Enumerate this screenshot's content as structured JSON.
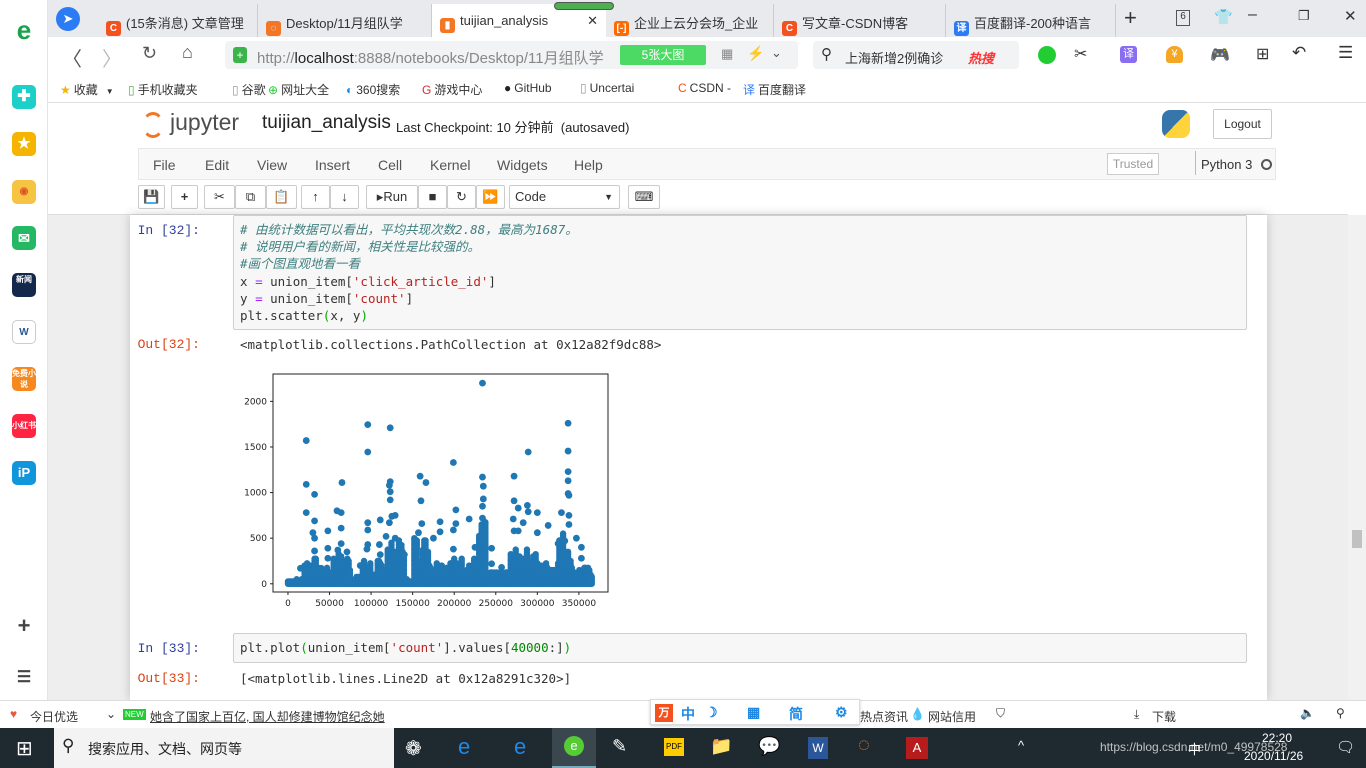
{
  "sidebar": {
    "icons": [
      "ie-logo-icon",
      "plus-app-icon",
      "star-icon",
      "weibo-icon",
      "mail-icon",
      "news-icon",
      "word-icon",
      "novel-icon",
      "xiaohongshu-icon",
      "ip-icon",
      "add-icon",
      "list-icon"
    ],
    "news_label": "新闻",
    "novel_label": "免费小说",
    "xhs_label": "小红书"
  },
  "tabs": [
    {
      "label": "(15条消息) 文章管理",
      "color": "#f4511e",
      "glyph": "C"
    },
    {
      "label": "Desktop/11月组队学",
      "color": "#f37626",
      "glyph": "◌"
    },
    {
      "label": "tuijian_analysis",
      "color": "#f37626",
      "glyph": "▮",
      "active": true
    },
    {
      "label": "企业上云分会场_企业",
      "color": "#ff6a00",
      "glyph": "[-]"
    },
    {
      "label": "写文章-CSDN博客",
      "color": "#f4511e",
      "glyph": "C"
    },
    {
      "label": "百度翻译-200种语言",
      "color": "#2b7bf5",
      "glyph": "译"
    }
  ],
  "tab_count": "6",
  "address": {
    "url_prefix": "http://",
    "url_host": "localhost",
    "url_rest": ":8888/notebooks/Desktop/11月组队学",
    "image_badge": "5张大图",
    "search_text": "上海新增2例确诊",
    "hot_label": "热搜"
  },
  "bookmarks": [
    "收藏",
    "手机收藏夹",
    "谷歌",
    "网址大全",
    "360搜索",
    "游戏中心",
    "GitHub",
    "Uncertai",
    "CSDN -",
    "百度翻译"
  ],
  "jupyter": {
    "logo": "jupyter",
    "notebook_name": "tuijian_analysis",
    "checkpoint": "Last Checkpoint: 10 分钟前",
    "autosaved": "(autosaved)",
    "logout": "Logout",
    "menu": [
      "File",
      "Edit",
      "View",
      "Insert",
      "Cell",
      "Kernel",
      "Widgets",
      "Help"
    ],
    "trusted": "Trusted",
    "kernel": "Python 3",
    "run_label": "Run",
    "cell_type": "Code"
  },
  "cells": [
    {
      "in_prompt": "In  [32]:",
      "lines": [
        "# 由统计数据可以看出，平均共现次数2.88，最高为1687。",
        "# 说明用户看的新闻，相关性是比较强的。",
        "#画个图直观地看一看"
      ],
      "code4a": "x ",
      "code4b": "=",
      "code4c": " union_item[",
      "code4d": "'click_article_id'",
      "code4e": "]",
      "code5a": "y ",
      "code5b": "=",
      "code5c": " union_item[",
      "code5d": "'count'",
      "code5e": "]",
      "code6a": "plt.scatter",
      "code6b": "(",
      "code6c": "x, y",
      "code6d": ")",
      "out_prompt": "Out[32]:",
      "out_text": "<matplotlib.collections.PathCollection at 0x12a82f9dc88>"
    },
    {
      "in_prompt": "In  [33]:",
      "c1": "plt.plot",
      "c2": "(",
      "c3": "union_item[",
      "c4": "'count'",
      "c5": "].values[",
      "c6": "40000",
      "c7": ":]",
      "c8": ")",
      "out_prompt": "Out[33]:",
      "out_text": "[<matplotlib.lines.Line2D at 0x12a8291c320>]"
    }
  ],
  "chart_data": {
    "type": "scatter",
    "color": "#1f77b4",
    "xlim": [
      -18000,
      385000
    ],
    "ylim": [
      -90,
      2300
    ],
    "xticks": [
      0,
      50000,
      100000,
      150000,
      200000,
      250000,
      300000,
      350000
    ],
    "xtick_labels": [
      "0",
      "50000",
      "100000",
      "150000",
      "200000",
      "250000",
      "300000",
      "350000"
    ],
    "yticks": [
      0,
      500,
      1000,
      1500,
      2000
    ],
    "ytick_labels": [
      "0",
      "500",
      "1000",
      "1500",
      "2000"
    ],
    "points": [
      [
        22000,
        1570
      ],
      [
        22000,
        1090
      ],
      [
        22000,
        780
      ],
      [
        32000,
        980
      ],
      [
        32000,
        690
      ],
      [
        30000,
        560
      ],
      [
        32000,
        500
      ],
      [
        32000,
        360
      ],
      [
        48000,
        580
      ],
      [
        48000,
        390
      ],
      [
        48000,
        280
      ],
      [
        59000,
        800
      ],
      [
        64000,
        780
      ],
      [
        65000,
        1110
      ],
      [
        64000,
        610
      ],
      [
        64000,
        440
      ],
      [
        60000,
        370
      ],
      [
        71000,
        350
      ],
      [
        96000,
        1745
      ],
      [
        96000,
        1445
      ],
      [
        96000,
        670
      ],
      [
        96000,
        590
      ],
      [
        96000,
        430
      ],
      [
        95000,
        380
      ],
      [
        111000,
        700
      ],
      [
        110000,
        430
      ],
      [
        111000,
        320
      ],
      [
        123000,
        1710
      ],
      [
        123000,
        1120
      ],
      [
        122000,
        1080
      ],
      [
        123000,
        1010
      ],
      [
        123000,
        920
      ],
      [
        125000,
        740
      ],
      [
        129000,
        750
      ],
      [
        122000,
        670
      ],
      [
        129000,
        500
      ],
      [
        118000,
        520
      ],
      [
        140000,
        320
      ],
      [
        159000,
        1180
      ],
      [
        160000,
        910
      ],
      [
        166000,
        1110
      ],
      [
        161000,
        660
      ],
      [
        157000,
        560
      ],
      [
        175000,
        500
      ],
      [
        183000,
        680
      ],
      [
        183000,
        570
      ],
      [
        199000,
        1330
      ],
      [
        202000,
        810
      ],
      [
        202000,
        660
      ],
      [
        199000,
        590
      ],
      [
        199000,
        380
      ],
      [
        218000,
        710
      ],
      [
        225000,
        400
      ],
      [
        234000,
        2200
      ],
      [
        234000,
        1170
      ],
      [
        235000,
        1070
      ],
      [
        235000,
        930
      ],
      [
        234000,
        850
      ],
      [
        234000,
        720
      ],
      [
        234000,
        580
      ],
      [
        245000,
        390
      ],
      [
        245000,
        220
      ],
      [
        257000,
        180
      ],
      [
        271000,
        710
      ],
      [
        272000,
        910
      ],
      [
        272000,
        1180
      ],
      [
        272000,
        580
      ],
      [
        277000,
        830
      ],
      [
        277000,
        580
      ],
      [
        283000,
        670
      ],
      [
        288000,
        860
      ],
      [
        289000,
        1445
      ],
      [
        289000,
        790
      ],
      [
        300000,
        780
      ],
      [
        300000,
        560
      ],
      [
        313000,
        640
      ],
      [
        329000,
        780
      ],
      [
        333000,
        470
      ],
      [
        325000,
        440
      ],
      [
        337000,
        1760
      ],
      [
        337000,
        1455
      ],
      [
        337000,
        1230
      ],
      [
        337000,
        1130
      ],
      [
        337000,
        990
      ],
      [
        338000,
        970
      ],
      [
        338000,
        750
      ],
      [
        338000,
        650
      ],
      [
        347000,
        500
      ],
      [
        353000,
        400
      ],
      [
        353000,
        280
      ],
      [
        15000,
        170
      ],
      [
        40000,
        170
      ],
      [
        87000,
        200
      ]
    ],
    "dense_bands": [
      [
        0,
        20000,
        60
      ],
      [
        20000,
        35000,
        300
      ],
      [
        35000,
        55000,
        200
      ],
      [
        55000,
        75000,
        350
      ],
      [
        75000,
        90000,
        100
      ],
      [
        90000,
        100000,
        300
      ],
      [
        100000,
        108000,
        120
      ],
      [
        108000,
        120000,
        300
      ],
      [
        120000,
        140000,
        480
      ],
      [
        140000,
        152000,
        60
      ],
      [
        152000,
        170000,
        550
      ],
      [
        170000,
        200000,
        280
      ],
      [
        200000,
        230000,
        300
      ],
      [
        230000,
        238000,
        700
      ],
      [
        238000,
        268000,
        150
      ],
      [
        268000,
        300000,
        400
      ],
      [
        300000,
        325000,
        250
      ],
      [
        325000,
        340000,
        600
      ],
      [
        340000,
        366000,
        200
      ]
    ]
  },
  "statusbar": {
    "left1": "今日优选",
    "news": "她含了国家上百亿, 国人却修建博物馆纪念她",
    "ime": [
      "中",
      "简"
    ],
    "right1": "热点资讯",
    "right2": "网站信用",
    "download": "下载"
  },
  "taskbar": {
    "search_placeholder": "搜索应用、文档、网页等",
    "time": "22:20",
    "date": "2020/11/26",
    "ime": "中",
    "watermark": "https://blog.csdn.net/m0_49978528"
  }
}
